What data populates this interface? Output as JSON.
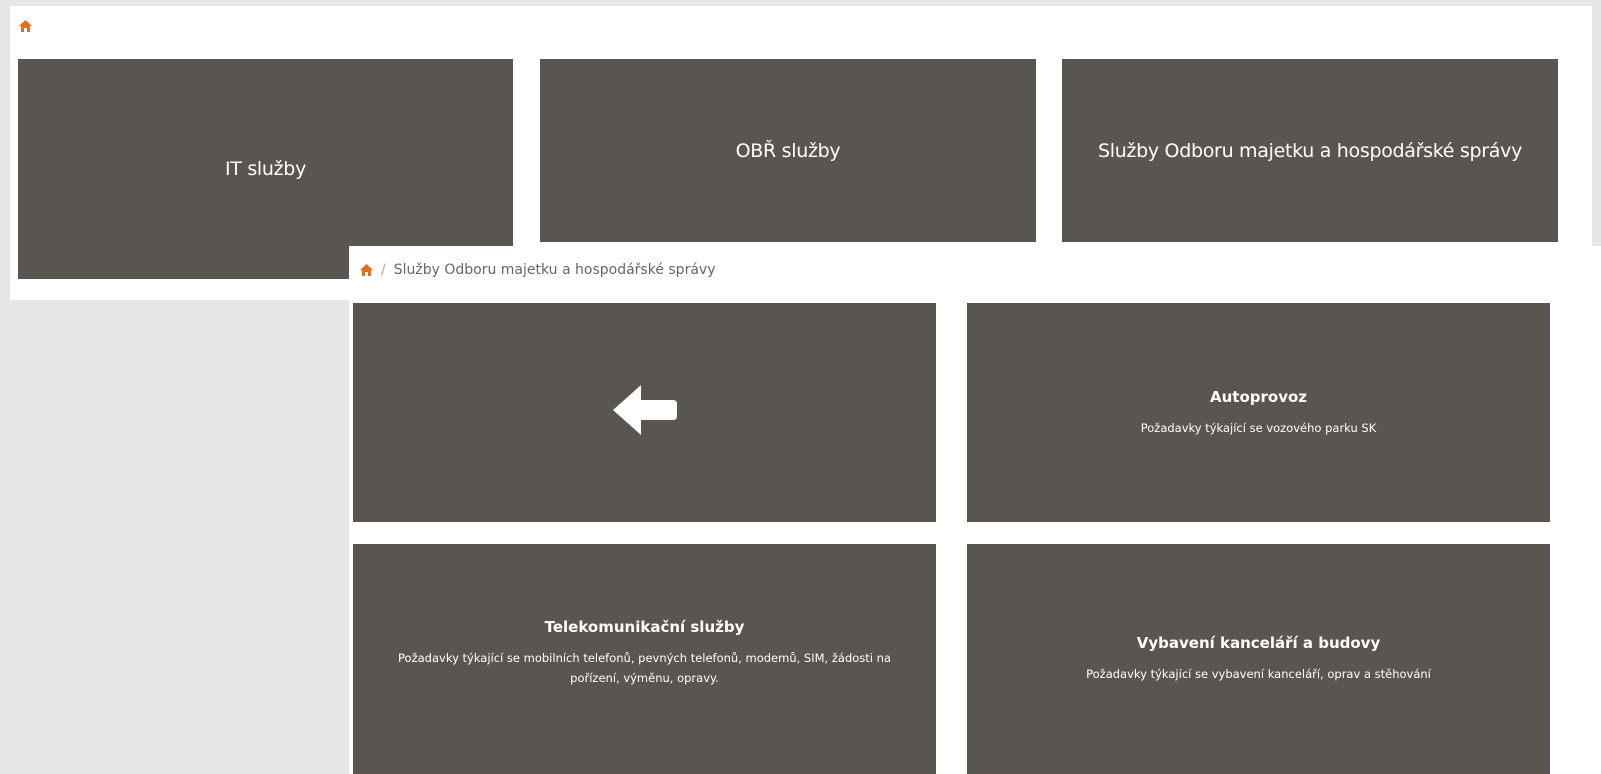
{
  "top_panel": {
    "tiles": [
      {
        "label": "IT služby"
      },
      {
        "label": "OBŘ služby"
      },
      {
        "label": "Služby Odboru majetku a hospodářské správy"
      }
    ]
  },
  "front_panel": {
    "breadcrumb": {
      "separator": "/",
      "current": "Služby Odboru majetku a hospodářské správy"
    },
    "tiles": [
      {
        "title": "Autoprovoz",
        "description": "Požadavky týkající se vozového parku SK"
      },
      {
        "title": "Telekomunikační služby",
        "description": "Požadavky týkající se mobilních telefonů, pevných telefonů, modemů, SIM, žádosti na pořízení, výměnu, opravy."
      },
      {
        "title": "Vybavení kanceláří a budovy",
        "description": "Požadavky týkající se vybavení kanceláří, oprav a stěhování"
      }
    ]
  },
  "colors": {
    "tile_bg": "#595652",
    "home_icon": "#e26c1f",
    "page_bg": "#e6e6e6"
  },
  "icons": [
    "home-icon",
    "arrow-left-icon"
  ]
}
